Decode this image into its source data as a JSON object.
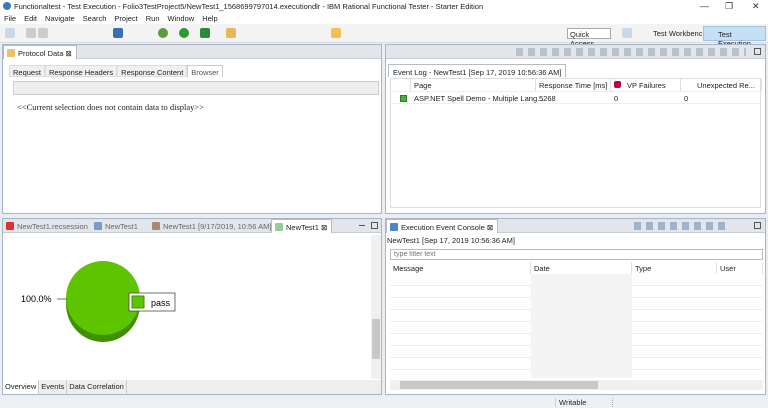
{
  "window": {
    "title": "Functionaltest - Test Execution - Folio3TestProject5/NewTest1_1568699797014.executiondlr - IBM Rational Functional Tester - Starter Edition",
    "minimize": "—",
    "restore": "❐",
    "close": "✕"
  },
  "menu": [
    "File",
    "Edit",
    "Navigate",
    "Search",
    "Project",
    "Run",
    "Window",
    "Help"
  ],
  "toolbar": {
    "quick_access": "Quick Access",
    "perspectives": [
      "Test Workbench",
      "Test Execution"
    ]
  },
  "protocol": {
    "tab": "Protocol Data",
    "subtabs": [
      "Request",
      "Response Headers",
      "Response Content",
      "Browser"
    ],
    "active_subtab": "Browser",
    "message": "<<Current selection does not contain data to display>>"
  },
  "eventlog": {
    "tab": "Event Log - NewTest1 [Sep 17, 2019 10:56:36 AM]",
    "columns": [
      "Page",
      "Response Time [ms]",
      "VP Failures",
      "Unexpected Re..."
    ],
    "rows": [
      {
        "page": "ASP.NET Spell Demo - Multiple Lang...",
        "response": "5268",
        "vp": "0",
        "unexpected": "0"
      }
    ]
  },
  "report": {
    "tabs": [
      "NewTest1.recsession",
      "NewTest1",
      "NewTest1 [9/17/2019, 10:56 AM]",
      "NewTest1"
    ],
    "bottom_tabs": [
      "Overview",
      "Events",
      "Data Correlation"
    ],
    "pie_label": "100.0%",
    "legend": "pass",
    "color": "#5fc400"
  },
  "console": {
    "tab": "Execution Event Console",
    "subtitle": "NewTest1 [Sep 17, 2019 10:56:36 AM]",
    "filter_placeholder": "type filter text",
    "columns": [
      "Message",
      "Date",
      "Type",
      "User"
    ]
  },
  "status": {
    "writable": "Writable"
  },
  "chart_data": {
    "type": "pie",
    "categories": [
      "pass"
    ],
    "values": [
      100
    ],
    "labels": [
      "100.0%"
    ]
  }
}
